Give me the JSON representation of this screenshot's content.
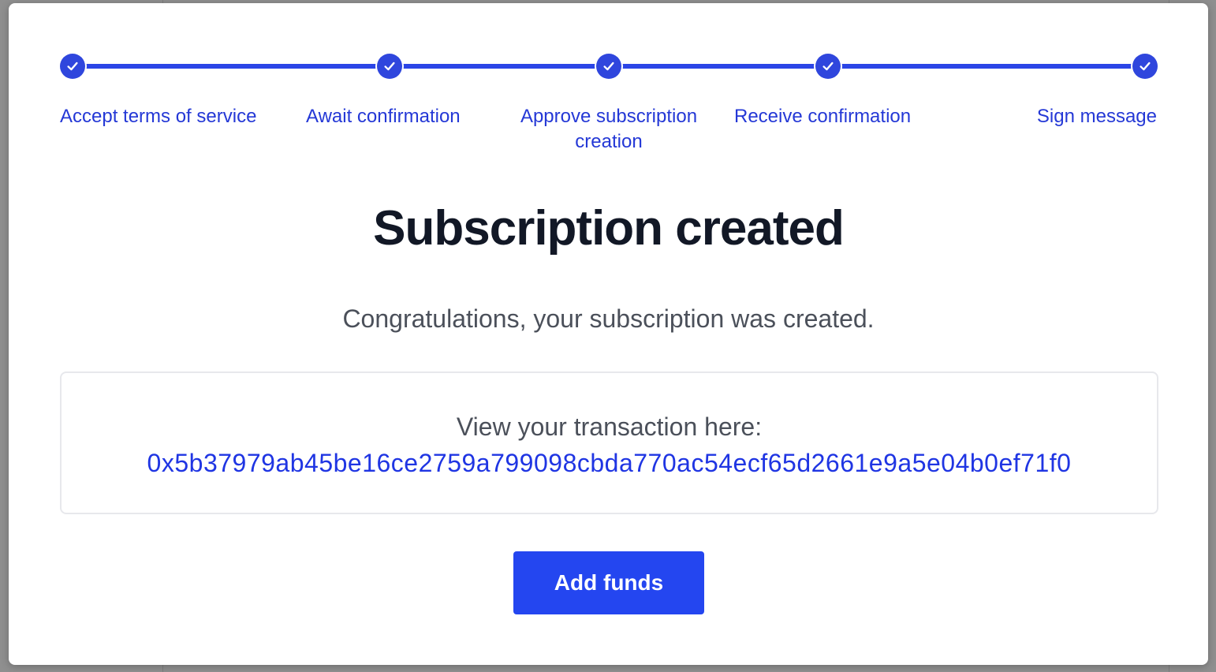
{
  "stepper": {
    "steps": [
      {
        "label": "Accept terms of service",
        "status": "complete",
        "icon": "check-icon"
      },
      {
        "label": "Await confirmation",
        "status": "complete",
        "icon": "check-icon"
      },
      {
        "label": "Approve subscription creation",
        "status": "complete",
        "icon": "check-icon"
      },
      {
        "label": "Receive confirmation",
        "status": "complete",
        "icon": "check-icon"
      },
      {
        "label": "Sign message",
        "status": "complete",
        "icon": "check-icon"
      }
    ],
    "accent_color": "#2f46dd"
  },
  "main": {
    "title": "Subscription created",
    "subtitle": "Congratulations, your subscription was created."
  },
  "transaction": {
    "label": "View your transaction here:",
    "hash": "0x5b37979ab45be16ce2759a799098cbda770ac54ecf65d2661e9a5e04b0ef71f0"
  },
  "actions": {
    "add_funds_label": "Add funds",
    "button_color": "#2446f0"
  }
}
